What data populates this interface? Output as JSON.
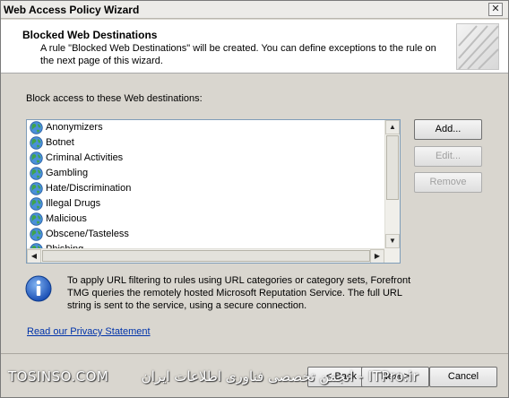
{
  "window": {
    "title": "Web Access Policy Wizard",
    "close_glyph": "✕"
  },
  "header": {
    "title": "Blocked Web Destinations",
    "description": "A rule \"Blocked Web Destinations\" will be created. You can define exceptions to the rule on the next page of this wizard."
  },
  "destinations": {
    "label": "Block access to these Web destinations:",
    "items": [
      "Anonymizers",
      "Botnet",
      "Criminal Activities",
      "Gambling",
      "Hate/Discrimination",
      "Illegal Drugs",
      "Malicious",
      "Obscene/Tasteless",
      "Phishing"
    ],
    "icon": "globe-icon"
  },
  "buttons": {
    "add": "Add...",
    "edit": "Edit...",
    "remove": "Remove",
    "back": "< Back",
    "next": "Next >",
    "cancel": "Cancel"
  },
  "info": {
    "text": "To apply URL filtering to rules using URL categories or category sets, Forefront TMG queries the remotely hosted Microsoft Reputation Service. The full URL string is sent to the service, using a secure connection."
  },
  "privacy_link": "Read our Privacy Statement",
  "watermark": {
    "left": "TOSINSO.COM",
    "right": "ITPro.ir - انجمن تخصصی فناوری اطلاعات ایران"
  },
  "colors": {
    "link": "#0033aa",
    "disabled_text": "#a0a0a0"
  }
}
